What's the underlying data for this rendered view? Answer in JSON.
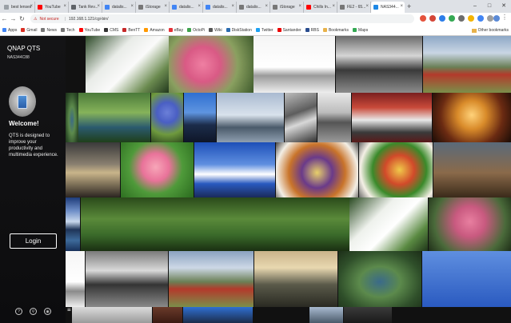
{
  "browser": {
    "tabs": [
      {
        "label": "best lenses",
        "color": "#9aa0a6"
      },
      {
        "label": "YouTube",
        "color": "#ff0000"
      },
      {
        "label": "Tank Rev...",
        "color": "#5f6368"
      },
      {
        "label": "datalis...",
        "color": "#4285f4"
      },
      {
        "label": "iStorage",
        "color": "#777777"
      },
      {
        "label": "datalis...",
        "color": "#4285f4"
      },
      {
        "label": "datalis...",
        "color": "#4285f4"
      },
      {
        "label": "datalis...",
        "color": "#777777"
      },
      {
        "label": "iStorage",
        "color": "#777777"
      },
      {
        "label": "Chills In...",
        "color": "#ff0000"
      },
      {
        "label": "FE2 - 65...",
        "color": "#777777"
      },
      {
        "label": "NAS344...",
        "color": "#1e88e5",
        "active": true
      }
    ],
    "window_controls": {
      "minimize": "–",
      "maximize": "□",
      "close": "✕"
    },
    "address": {
      "security": "Not secure",
      "url": "192.168.1.121/cgi-bin/"
    },
    "bookmarks": [
      {
        "label": "Apps",
        "color": "#4285f4"
      },
      {
        "label": "Gmail",
        "color": "#d93025"
      },
      {
        "label": "News",
        "color": "#777777"
      },
      {
        "label": "Tech",
        "color": "#777777"
      },
      {
        "label": "YouTube",
        "color": "#ff0000"
      },
      {
        "label": "CMS",
        "color": "#333333"
      },
      {
        "label": "BenTT",
        "color": "#c62828"
      },
      {
        "label": "Amazon",
        "color": "#ff9900"
      },
      {
        "label": "eBay",
        "color": "#e53238"
      },
      {
        "label": "OctoPi",
        "color": "#3fa34d"
      },
      {
        "label": "Wiki",
        "color": "#555555"
      },
      {
        "label": "DiskStation",
        "color": "#2b6cb0"
      },
      {
        "label": "Twitter",
        "color": "#1da1f2"
      },
      {
        "label": "Santander",
        "color": "#ec0000"
      },
      {
        "label": "RBS",
        "color": "#2a4d8f"
      },
      {
        "label": "Bookmarks",
        "color": "#e8b24a"
      },
      {
        "label": "Maps",
        "color": "#34a853"
      }
    ],
    "other_bookmarks": "Other bookmarks"
  },
  "sidebar": {
    "brand": "QNAP QTS",
    "hostname": "NAS344C88",
    "welcome": "Welcome!",
    "description": "QTS is designed to improve your productivity and multimedia experience.",
    "login_label": "Login",
    "bottom_icons": [
      "help-icon",
      "search-icon",
      "language-icon"
    ]
  },
  "photos": [
    {
      "name": "photo-white-cyclamen",
      "bg": "linear-gradient(135deg,#2d4a28 0%,#e9ece8 35%,#fafafa 55%,#6a8a4f 80%,#22381d 100%)"
    },
    {
      "name": "photo-pink-blossom",
      "bg": "radial-gradient(circle at 40% 50%,#ef7fa2 0%,#d95a85 30%,#8aa060 60%,#3e5a2c 100%)"
    },
    {
      "name": "photo-white-pier",
      "bg": "linear-gradient(180deg,#f5f5f5 0%,#ffffff 55%,#9a9a9a 70%,#eeeeee 100%)"
    },
    {
      "name": "photo-bw-rocks",
      "bg": "linear-gradient(180deg,#6a6a6a 0%,#d5d5d5 35%,#3a3a3a 60%,#8c8c8c 100%)"
    },
    {
      "name": "photo-red-tractor",
      "bg": "linear-gradient(180deg,#8ea8c6 0%,#c9d6e4 30%,#6a7f55 55%,#b33a2b 68%,#7a8f4a 100%)"
    },
    {
      "name": "photo-heart-lake-1",
      "bg": "radial-gradient(ellipse at 50% 55%,#3b6a88 0%,#5c8a4c 35%,#2f4f2a 70%,#1c2e18 100%)"
    },
    {
      "name": "photo-green-puddle",
      "bg": "linear-gradient(180deg,#4b7a3a 0%,#86b35a 40%,#2b5a6e 70%,#1f3f1a 100%)"
    },
    {
      "name": "photo-blue-flowers",
      "bg": "radial-gradient(circle at 50% 40%,#6b7fd8 0%,#4a5fc4 30%,#6f9a3e 65%,#2e4a1e 100%)"
    },
    {
      "name": "photo-lake-house",
      "bg": "linear-gradient(180deg,#2f6fd1 0%,#5f95e0 40%,#1c2c4a 65%,#0e1628 100%)"
    },
    {
      "name": "photo-harbor-boats",
      "bg": "linear-gradient(180deg,#a9bad0 0%,#d9e2ec 45%,#4a5a6a 70%,#8f9fb0 100%)"
    },
    {
      "name": "photo-bw-coast",
      "bg": "linear-gradient(160deg,#bdbdbd 0%,#5d5d5d 40%,#d8d8d8 60%,#2f2f2f 100%)"
    },
    {
      "name": "photo-bw-canal",
      "bg": "linear-gradient(180deg,#e8e8e8 0%,#bcbcbc 40%,#555555 60%,#9a9a9a 100%)"
    },
    {
      "name": "photo-race-car",
      "bg": "linear-gradient(180deg,#7a1f1f 0%,#c94a3a 30%,#e8e8e8 55%,#3a3a3a 80%,#5a1a1a 100%)"
    },
    {
      "name": "photo-carousel",
      "bg": "radial-gradient(circle at 50% 45%,#ffd27a 0%,#d98b2a 30%,#6a2a12 65%,#1a0c06 100%)"
    },
    {
      "name": "photo-rain-window",
      "bg": "linear-gradient(180deg,#3a3a3a 0%,#8a8070 40%,#c9b58a 55%,#2a2420 100%)"
    },
    {
      "name": "photo-pink-camellia",
      "bg": "radial-gradient(circle at 48% 45%,#f7a6b8 0%,#e9739a 28%,#4f9a3a 55%,#2a6a1e 100%)"
    },
    {
      "name": "photo-blue-sky-clouds",
      "bg": "linear-gradient(180deg,#1d4fb8 0%,#5f8fe0 40%,#ffffff 58%,#2a5ac0 75%,#1a2a5a 100%)"
    },
    {
      "name": "photo-food-plate",
      "bg": "radial-gradient(circle at 50% 55%,#e8d06a 0%,#6a3a8a 30%,#c9742a 55%,#f3efe6 80%,#444 100%)"
    },
    {
      "name": "photo-salad-dish",
      "bg": "radial-gradient(circle at 55% 50%,#f0c94a 0%,#d24a2a 30%,#3a8a2a 55%,#f5f0e6 80%,#6a6a6a 100%)"
    },
    {
      "name": "photo-castle-edge",
      "bg": "linear-gradient(180deg,#5a6a7a 0%,#8a6a4a 55%,#3a2a1a 100%)"
    },
    {
      "name": "photo-panorama-coast",
      "bg": "linear-gradient(180deg,#1e3c7a 0%,#6f8fc8 25%,#c9d8ec 45%,#1f3558 60%,#3d6a9a 80%,#17305a 100%)"
    },
    {
      "name": "photo-green-trees",
      "bg": "linear-gradient(180deg,#2a4a1a 0%,#5a8a3a 40%,#3a6a2a 70%,#1a2f12 100%)"
    },
    {
      "name": "photo-white-cyclamen-2",
      "bg": "linear-gradient(135deg,#2a4a22 0%,#eef1ec 35%,#ffffff 55%,#5a8a42 80%,#1f3519 100%)"
    },
    {
      "name": "photo-pink-blossom-2",
      "bg": "radial-gradient(circle at 50% 45%,#e87fa0 0%,#c95a80 30%,#4a6a3a 70%,#1f2f18 100%)"
    },
    {
      "name": "photo-white-pier-2",
      "bg": "linear-gradient(180deg,#f5f5f5 0%,#ffffff 55%,#8a8a8a 72%,#efefef 100%)"
    },
    {
      "name": "photo-bw-rocks-2",
      "bg": "linear-gradient(180deg,#7a7a7a 0%,#dadada 35%,#343434 60%,#8a8a8a 100%)"
    },
    {
      "name": "photo-red-tractor-2",
      "bg": "linear-gradient(180deg,#8aa2c0 0%,#cdd8e6 30%,#6a7f55 55%,#b33a2b 68%,#7a8f4a 100%)"
    },
    {
      "name": "photo-street-sunset",
      "bg": "linear-gradient(180deg,#c9b38a 0%,#e8d8b0 30%,#5a5a4a 60%,#2a2a22 100%)"
    },
    {
      "name": "photo-heart-lake-2",
      "bg": "radial-gradient(ellipse at 50% 55%,#3a6a8a 0%,#5c8a4c 35%,#2f4f2a 70%,#1c2e18 100%)"
    },
    {
      "name": "photo-bottom-1",
      "bg": "linear-gradient(180deg,#5f8fe0 0%,#2a5ac0 100%)"
    },
    {
      "name": "photo-bottom-2",
      "bg": "linear-gradient(180deg,#dcdcdc 0%,#9a9a9a 100%)"
    },
    {
      "name": "photo-bottom-3",
      "bg": "linear-gradient(180deg,#6a3a2a 0%,#3a1a12 100%)"
    },
    {
      "name": "photo-bottom-4",
      "bg": "linear-gradient(180deg,#2f6fd1 0%,#1c2c4a 100%)"
    },
    {
      "name": "photo-bottom-5",
      "bg": "linear-gradient(180deg,#a9bad0 0%,#4a5a6a 100%)"
    },
    {
      "name": "photo-bottom-6",
      "bg": "linear-gradient(180deg,#3a3a3a 0%,#1a1a1a 100%)"
    }
  ]
}
